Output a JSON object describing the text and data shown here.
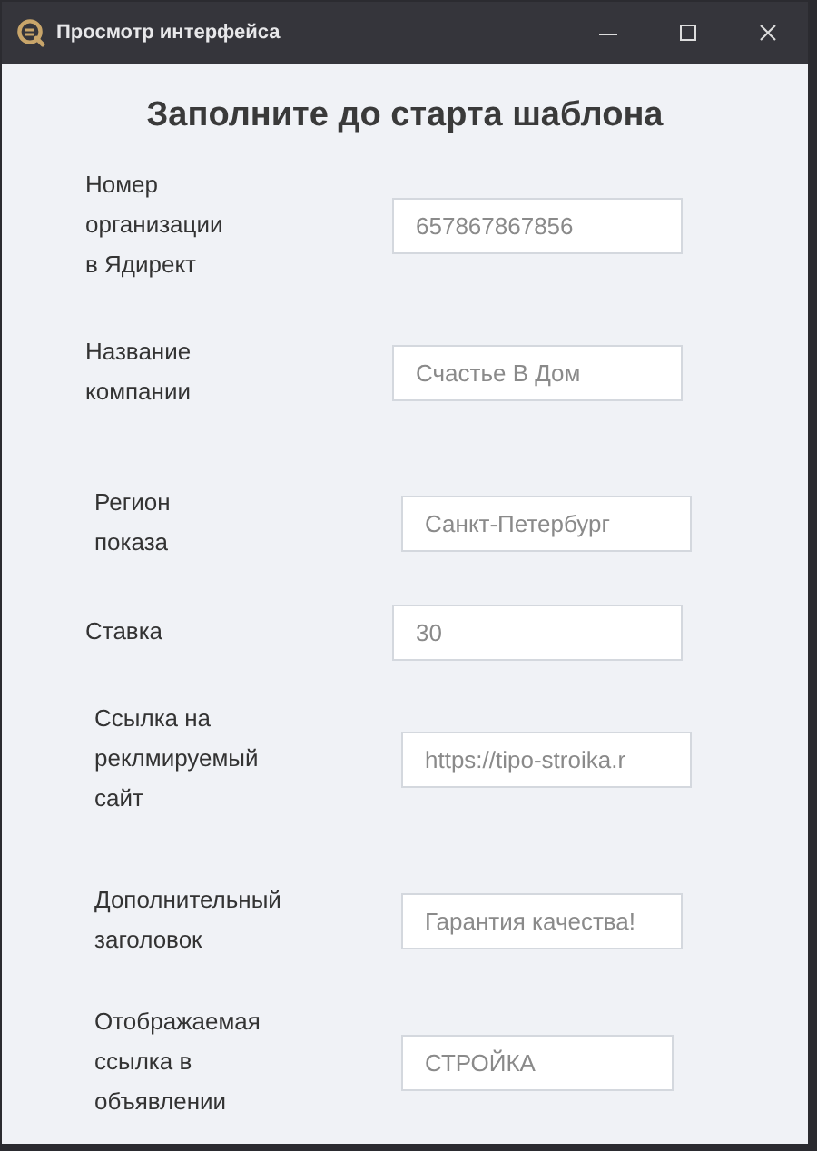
{
  "window": {
    "title": "Просмотр интерфейса"
  },
  "heading": "Заполните до старта шаблона",
  "fields": [
    {
      "label": "Номер\nорганизации\nв Ядирект",
      "value": "657867867856"
    },
    {
      "label": "Название\nкомпании",
      "value": "Счастье В Дом"
    },
    {
      "label": "Регион\nпоказа",
      "value": "Санкт-Петербург"
    },
    {
      "label": "Ставка",
      "value": "30"
    },
    {
      "label": "Ссылка на\nреклмируемый\nсайт",
      "value": "https://tipo-stroika.r"
    },
    {
      "label": "Дополнительный\nзаголовок",
      "value": "Гарантия качества!"
    },
    {
      "label": "Отображаемая\nссылка в\nобъявлении",
      "value": "СТРОЙКА"
    }
  ]
}
